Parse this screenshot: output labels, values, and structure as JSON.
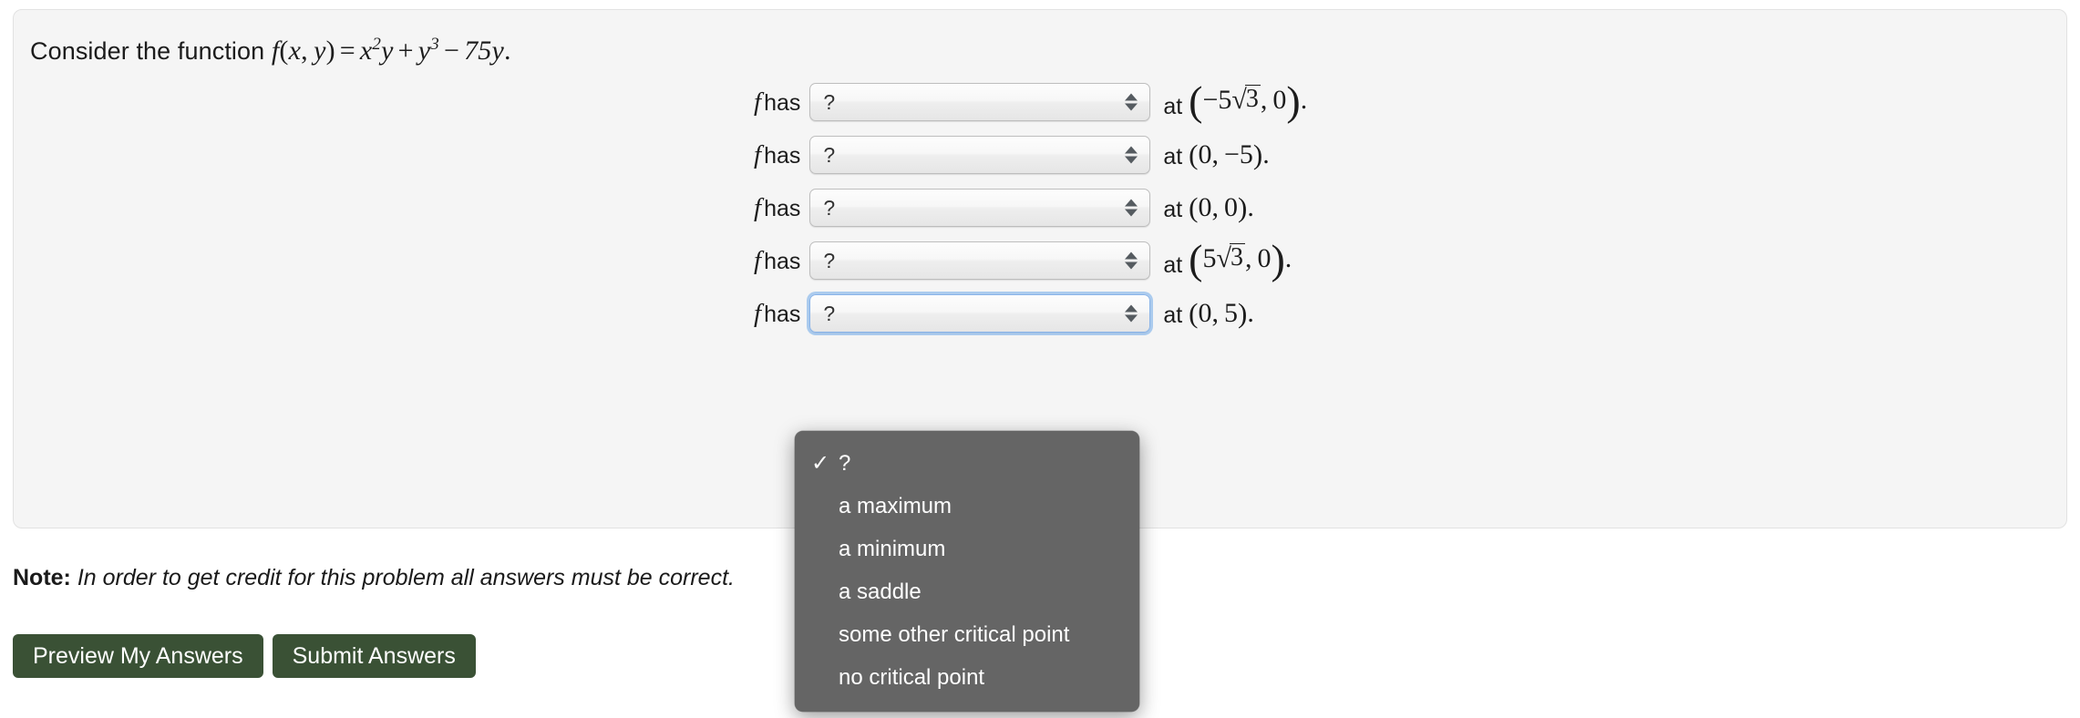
{
  "problem": {
    "prompt_prefix": "Consider the function",
    "function_parts": {
      "f": "f",
      "open": "(",
      "x": "x",
      "comma": ",",
      "y": "y",
      "close": ")",
      "equals": "=",
      "term1_base": "x",
      "term1_exp": "2",
      "term1_var": "y",
      "plus": "+",
      "term2_base": "y",
      "term2_exp": "3",
      "minus": "−",
      "term3": "75y",
      "period": "."
    }
  },
  "rows": [
    {
      "label_f": "f",
      "label_has": "has",
      "select_value": "?",
      "at_word": "at",
      "point": {
        "style": "tall",
        "open": "(",
        "x_sign": "−5",
        "x_radical": "3",
        "comma": ",",
        "y": "0",
        "close": ")",
        "period": "."
      },
      "focused": false
    },
    {
      "label_f": "f",
      "label_has": "has",
      "select_value": "?",
      "at_word": "at",
      "point": {
        "style": "plain",
        "open": "(",
        "x": "0",
        "comma": ",",
        "y": "−5",
        "close": ")",
        "period": "."
      },
      "focused": false
    },
    {
      "label_f": "f",
      "label_has": "has",
      "select_value": "?",
      "at_word": "at",
      "point": {
        "style": "plain",
        "open": "(",
        "x": "0",
        "comma": ",",
        "y": "0",
        "close": ")",
        "period": "."
      },
      "focused": false
    },
    {
      "label_f": "f",
      "label_has": "has",
      "select_value": "?",
      "at_word": "at",
      "point": {
        "style": "tall",
        "open": "(",
        "x_sign": "5",
        "x_radical": "3",
        "comma": ",",
        "y": "0",
        "close": ")",
        "period": "."
      },
      "focused": false
    },
    {
      "label_f": "f",
      "label_has": "has",
      "select_value": "?",
      "at_word": "at",
      "point": {
        "style": "plain",
        "open": "(",
        "x": "0",
        "comma": ",",
        "y": "5",
        "close": ")",
        "period": "."
      },
      "focused": true
    }
  ],
  "dropdown": {
    "open": true,
    "attached_to_row": 5,
    "checkmark": "✓",
    "options": [
      {
        "label": "?",
        "selected": true
      },
      {
        "label": "a maximum",
        "selected": false
      },
      {
        "label": "a minimum",
        "selected": false
      },
      {
        "label": "a saddle",
        "selected": false
      },
      {
        "label": "some other critical point",
        "selected": false
      },
      {
        "label": "no critical point",
        "selected": false
      }
    ]
  },
  "note": {
    "bold_prefix": "Note:",
    "text": "In order to get credit for this problem all answers must be correct."
  },
  "buttons": {
    "preview": "Preview My Answers",
    "submit": "Submit Answers"
  },
  "colors": {
    "panel_bg": "#f5f5f5",
    "panel_border": "#e2e2e2",
    "button_green": "#3a5135",
    "menu_bg": "#656565",
    "focus_ring": "#6ea8e8"
  }
}
